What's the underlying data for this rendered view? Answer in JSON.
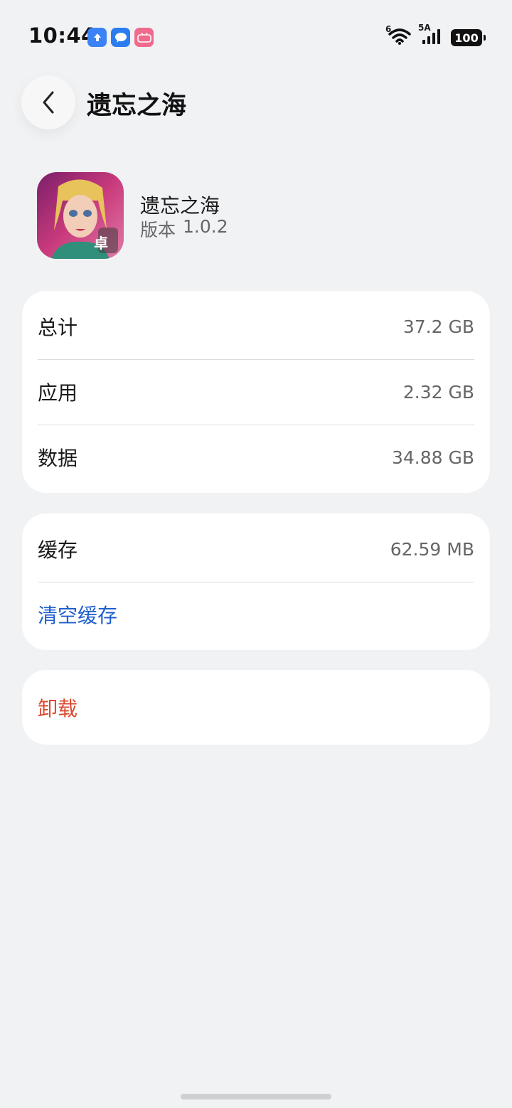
{
  "status_bar": {
    "time": "10:44",
    "battery": "100",
    "wifi_label": "6",
    "signal_label": "5A",
    "icons": [
      "upload-app-icon",
      "message-app-icon",
      "bilibili-icon",
      "wifi-icon",
      "cellular-signal-icon",
      "battery-icon"
    ]
  },
  "header": {
    "title": "遗忘之海",
    "back_icon": "chevron-left-icon"
  },
  "app_info": {
    "name": "遗忘之海",
    "version_label": "版本",
    "version": "1.0.2",
    "icon_badge": "卓"
  },
  "storage": {
    "rows": [
      {
        "label": "总计",
        "value": "37.2 GB"
      },
      {
        "label": "应用",
        "value": "2.32 GB"
      },
      {
        "label": "数据",
        "value": "34.88 GB"
      }
    ]
  },
  "cache": {
    "label": "缓存",
    "value": "62.59 MB",
    "clear_label": "清空缓存"
  },
  "uninstall": {
    "label": "卸载"
  },
  "colors": {
    "background": "#f1f2f4",
    "card": "#ffffff",
    "link_blue": "#1f5fcf",
    "danger_red": "#d9492f"
  }
}
